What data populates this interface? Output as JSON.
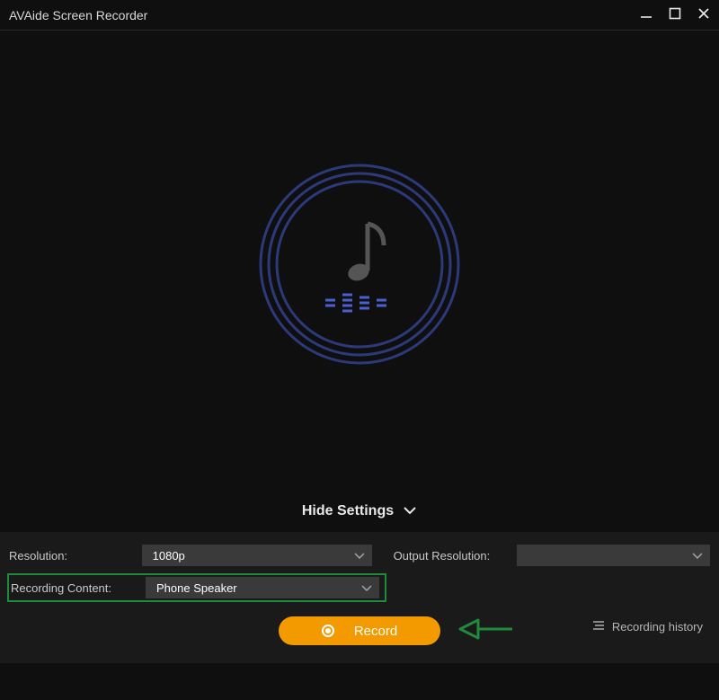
{
  "window": {
    "title": "AVAide Screen Recorder"
  },
  "center": {
    "icon": "music-note"
  },
  "toggle": {
    "label": "Hide Settings"
  },
  "settings": {
    "resolution": {
      "label": "Resolution:",
      "value": "1080p"
    },
    "output_resolution": {
      "label": "Output Resolution:",
      "value": ""
    },
    "recording_content": {
      "label": "Recording Content:",
      "value": "Phone Speaker"
    }
  },
  "actions": {
    "record": "Record",
    "history": "Recording history"
  }
}
